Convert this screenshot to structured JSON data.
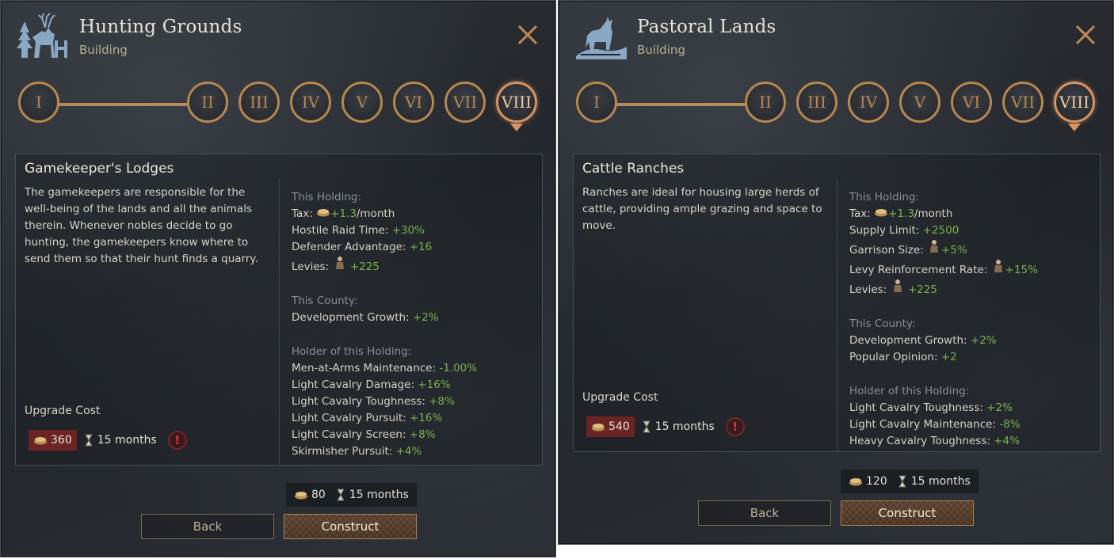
{
  "levels": [
    "I",
    "II",
    "III",
    "IV",
    "V",
    "VI",
    "VII",
    "VIII"
  ],
  "icons": {
    "hunting": "deer-tree-icon",
    "pastoral": "cattle-icon",
    "close": "close-icon",
    "gold": "gold-coins-icon",
    "time": "hourglass-icon",
    "warning": "warning-icon",
    "levies": "soldier-icon"
  },
  "colors": {
    "accent": "#b6874f",
    "selected": "#d99360",
    "positive": "#7ab24d",
    "warning": "#d83a3a"
  },
  "left": {
    "title": "Hunting Grounds",
    "subtitle": "Building",
    "selected_level": "VIII",
    "info": {
      "name": "Gamekeeper's Lodges",
      "description": "The gamekeepers are responsible for the well-being of the lands and all the animals therein. Whenever nobles decide to go hunting, the gamekeepers know where to send them so that their hunt finds a quarry.",
      "this_holding_label": "This Holding:",
      "this_holding": [
        {
          "label": "Tax:",
          "value": "+1.3",
          "suffix": "/month"
        },
        {
          "label": "Hostile Raid Time:",
          "value": "+30%"
        },
        {
          "label": "Defender Advantage:",
          "value": "+16"
        },
        {
          "label": "Levies:",
          "value": "+225"
        }
      ],
      "this_county_label": "This County:",
      "this_county": [
        {
          "label": "Development Growth:",
          "value": "+2%"
        }
      ],
      "holder_label": "Holder of this Holding:",
      "holder": [
        {
          "label": "Men-at-Arms Maintenance:",
          "value": "-1.00%"
        },
        {
          "label": "Light Cavalry Damage:",
          "value": "+16%"
        },
        {
          "label": "Light Cavalry Toughness:",
          "value": "+8%"
        },
        {
          "label": "Light Cavalry Pursuit:",
          "value": "+16%"
        },
        {
          "label": "Light Cavalry Screen:",
          "value": "+8%"
        },
        {
          "label": "Skirmisher Pursuit:",
          "value": "+4%"
        }
      ],
      "upgrade_cost_label": "Upgrade Cost",
      "upgrade_gold": "360",
      "upgrade_time": "15 months",
      "warning": "!"
    },
    "cost_gold": "80",
    "cost_time": "15 months",
    "back_label": "Back",
    "construct_label": "Construct"
  },
  "right": {
    "title": "Pastoral Lands",
    "subtitle": "Building",
    "selected_level": "VIII",
    "info": {
      "name": "Cattle Ranches",
      "description": "Ranches are ideal for housing large herds of cattle, providing ample grazing and space to move.",
      "this_holding_label": "This Holding:",
      "this_holding": [
        {
          "label": "Tax:",
          "value": "+1.3",
          "suffix": "/month"
        },
        {
          "label": "Supply Limit:",
          "value": "+2500"
        },
        {
          "label": "Garrison Size:",
          "value": "+5%"
        },
        {
          "label": "Levy Reinforcement Rate:",
          "value": "+15%"
        },
        {
          "label": "Levies:",
          "value": "+225"
        }
      ],
      "this_county_label": "This County:",
      "this_county": [
        {
          "label": "Development Growth:",
          "value": "+2%"
        },
        {
          "label": "Popular Opinion:",
          "value": "+2"
        }
      ],
      "holder_label": "Holder of this Holding:",
      "holder": [
        {
          "label": "Light Cavalry Toughness:",
          "value": "+2%"
        },
        {
          "label": "Light Cavalry Maintenance:",
          "value": "-8%"
        },
        {
          "label": "Heavy Cavalry Toughness:",
          "value": "+4%"
        }
      ],
      "upgrade_cost_label": "Upgrade Cost",
      "upgrade_gold": "540",
      "upgrade_time": "15 months",
      "warning": "!"
    },
    "cost_gold": "120",
    "cost_time": "15 months",
    "back_label": "Back",
    "construct_label": "Construct"
  }
}
